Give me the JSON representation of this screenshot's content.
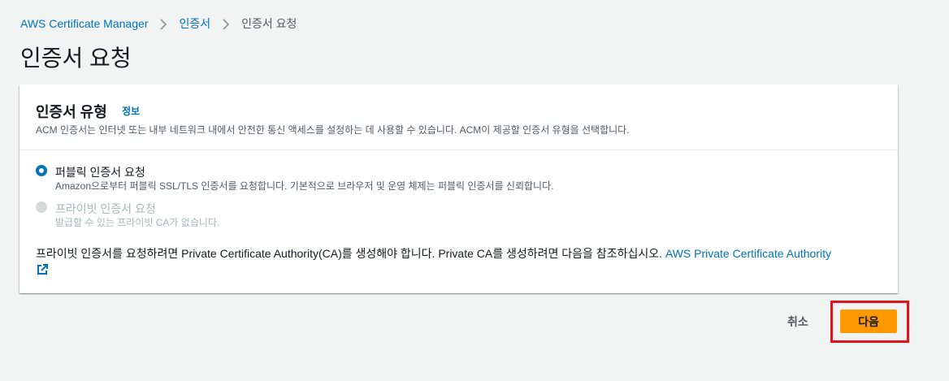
{
  "breadcrumb": {
    "items": [
      "AWS Certificate Manager",
      "인증서",
      "인증서 요청"
    ]
  },
  "page": {
    "title": "인증서 요청"
  },
  "panel": {
    "title": "인증서 유형",
    "info_label": "정보",
    "description": "ACM 인증서는 인터넷 또는 내부 네트워크 내에서 안전한 통신 액세스를 설정하는 데 사용할 수 있습니다. ACM이 제공할 인증서 유형을 선택합니다."
  },
  "options": [
    {
      "label": "퍼블릭 인증서 요청",
      "description": "Amazon으로부터 퍼블릭 SSL/TLS 인증서를 요청합니다. 기본적으로 브라우저 및 운영 체제는 퍼블릭 인증서를 신뢰합니다.",
      "selected": true,
      "disabled": false
    },
    {
      "label": "프라이빗 인증서 요청",
      "description": "발급할 수 있는 프라이빗 CA가 없습니다.",
      "selected": false,
      "disabled": true
    }
  ],
  "note": {
    "text": "프라이빗 인증서를 요청하려면 Private Certificate Authority(CA)를 생성해야 합니다. Private CA를 생성하려면 다음을 참조하십시오. ",
    "link_text": "AWS Private Certificate Authority"
  },
  "actions": {
    "cancel_label": "취소",
    "next_label": "다음"
  },
  "colors": {
    "accent": "#0073bb",
    "primary_button": "#ff9900",
    "highlight": "#e2141b",
    "background": "#f2f3f3"
  },
  "icons": {
    "breadcrumb_separator": "chevron-right-icon",
    "external_link": "external-link-icon"
  }
}
